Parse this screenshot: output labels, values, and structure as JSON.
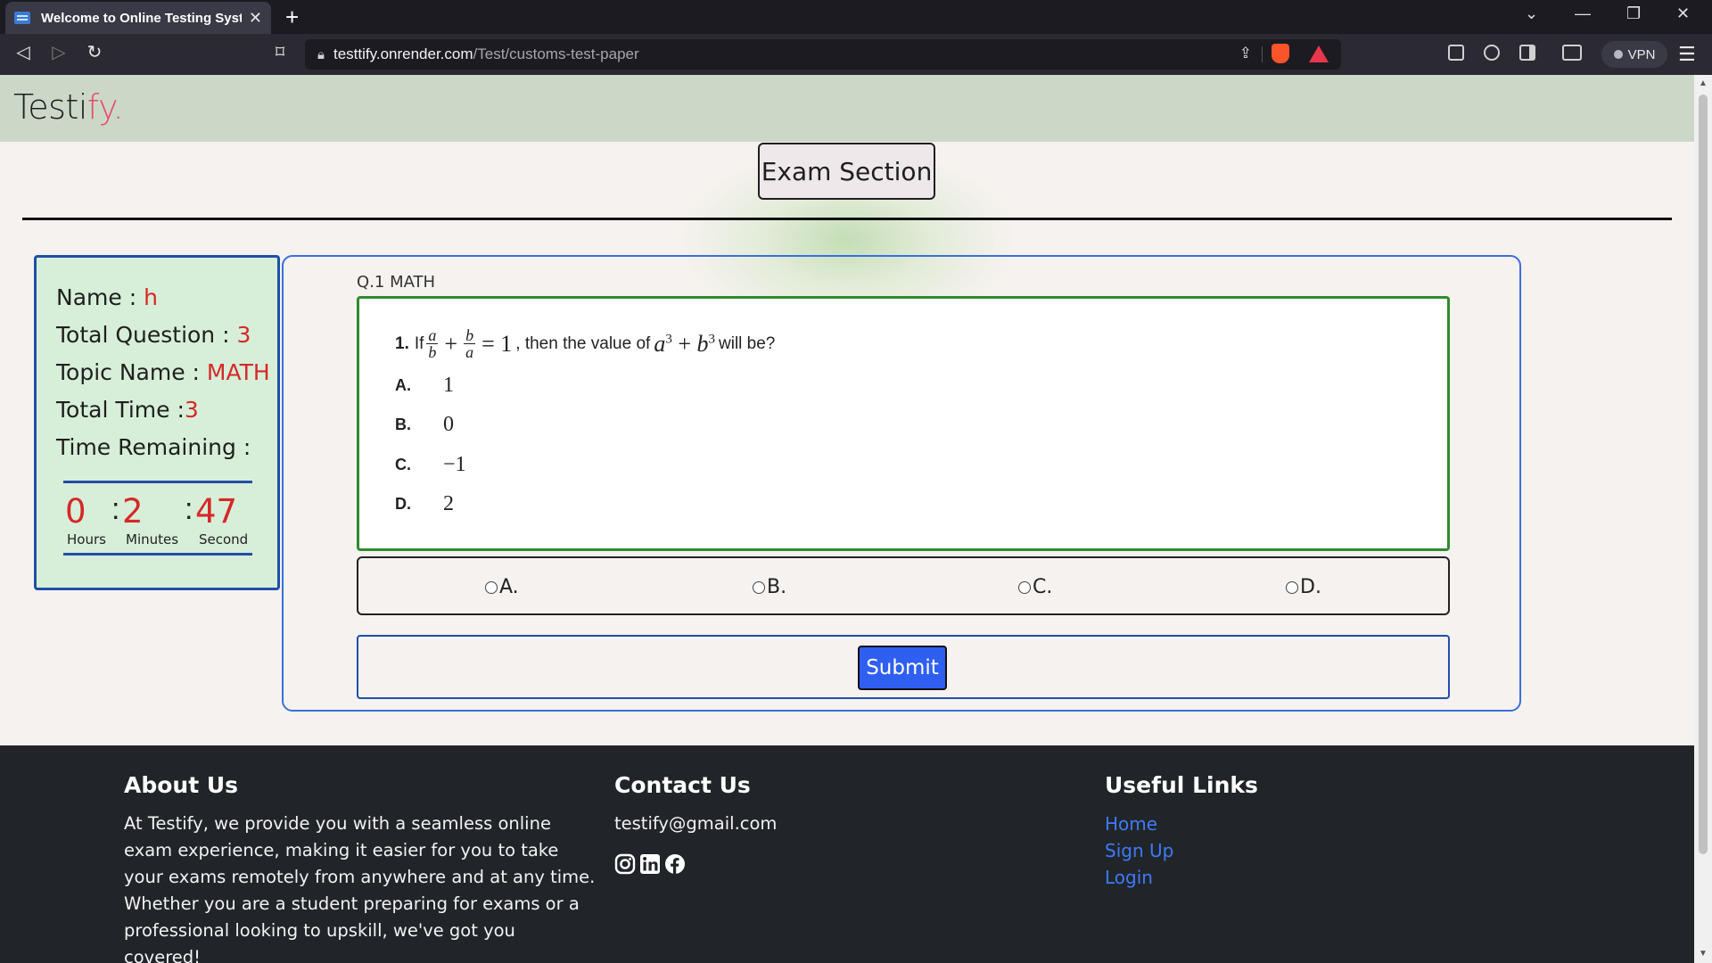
{
  "browser": {
    "tab_title": "Welcome to Online Testing System",
    "tab_close": "✕",
    "new_tab": "+",
    "url_host": "testtify.onrender.com",
    "url_path": "/Test/customs-test-paper",
    "vpn_label": "VPN",
    "window_controls": [
      "⌄",
      "—",
      "❐",
      "✕"
    ]
  },
  "header": {
    "brand_main": "Testi",
    "brand_accent": "fy."
  },
  "exam": {
    "title": "Exam Section"
  },
  "info": {
    "name_label": "Name : ",
    "name_value": "h",
    "total_question_label": "Total Question : ",
    "total_question_value": "3",
    "topic_label": "Topic Name : ",
    "topic_value": "MATH",
    "total_time_label": "Total Time :",
    "total_time_value": "3",
    "remaining_label": "Time Remaining :",
    "timer": {
      "hours": "0",
      "minutes": "2",
      "seconds": "47",
      "hours_label": "Hours",
      "minutes_label": "Minutes",
      "seconds_label": "Second"
    }
  },
  "question": {
    "label": "Q.1 MATH",
    "number": "1.",
    "prefix": "If",
    "middle": ", then the value of",
    "suffix": "will be?",
    "options": [
      {
        "letter": "A.",
        "value": "1"
      },
      {
        "letter": "B.",
        "value": "0"
      },
      {
        "letter": "C.",
        "value": "−1"
      },
      {
        "letter": "D.",
        "value": "2"
      }
    ]
  },
  "answers": [
    "A.",
    "B.",
    "C.",
    "D."
  ],
  "submit_label": "Submit",
  "footer": {
    "about": {
      "heading": "About Us",
      "text": "At Testify, we provide you with a seamless online exam experience, making it easier for you to take your exams remotely from anywhere and at any time. Whether you are a student preparing for exams or a professional looking to upskill, we've got you covered!"
    },
    "contact": {
      "heading": "Contact Us",
      "email": "testify@gmail.com",
      "social_icons": [
        "instagram-icon",
        "linkedin-icon",
        "facebook-icon"
      ]
    },
    "links": {
      "heading": "Useful Links",
      "items": [
        "Home",
        "Sign Up",
        "Login"
      ]
    }
  },
  "colors": {
    "accent_red": "#d62828",
    "brand_pink": "#e64b6b",
    "primary_blue": "#2f5ff0",
    "header_green": "#cbd8c8",
    "info_bg": "#d7efd8",
    "footer_bg": "#212529"
  }
}
